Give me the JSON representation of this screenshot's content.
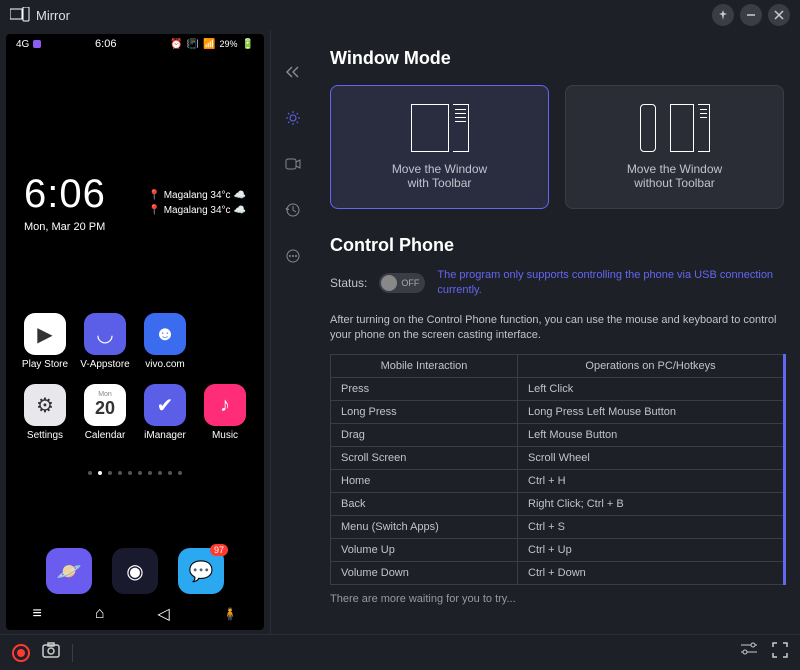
{
  "app": {
    "title": "Mirror"
  },
  "phone": {
    "status": {
      "time": "6:06",
      "battery": "29%",
      "signal": "4G"
    },
    "clock": {
      "time": "6:06",
      "date": "Mon, Mar 20 PM"
    },
    "weather": [
      {
        "text": "Magalang 34°c"
      },
      {
        "text": "Magalang 34°c"
      }
    ],
    "apps_row1": [
      {
        "label": "Play Store",
        "bg": "#ffffff",
        "glyph": "▶"
      },
      {
        "label": "V-Appstore",
        "bg": "#5b5fe8",
        "glyph": "◡"
      },
      {
        "label": "vivo.com",
        "bg": "#3b6cf0",
        "glyph": "☻"
      }
    ],
    "apps_row2": [
      {
        "label": "Settings",
        "bg": "#e8e8ec",
        "glyph": "⚙"
      },
      {
        "label": "Calendar",
        "bg": "#ffffff",
        "glyph": "20",
        "sub": "Mon"
      },
      {
        "label": "iManager",
        "bg": "#5b5fe8",
        "glyph": "✔"
      },
      {
        "label": "Music",
        "bg": "#ff2d78",
        "glyph": "♪"
      }
    ],
    "dock": [
      {
        "name": "browser",
        "bg": "#6b5cf0",
        "glyph": "🪐"
      },
      {
        "name": "camera",
        "bg": "#1a1a2e",
        "glyph": "◉"
      },
      {
        "name": "messages",
        "bg": "#2aa8f0",
        "glyph": "💬",
        "badge": "97"
      }
    ]
  },
  "content": {
    "window_mode_title": "Window Mode",
    "mode_with": "Move the Window\nwith Toolbar",
    "mode_without": "Move the Window\nwithout Toolbar",
    "control_phone_title": "Control Phone",
    "status_label": "Status:",
    "toggle_text": "OFF",
    "status_hint": "The program only supports controlling the phone via USB connection currently.",
    "control_desc": "After turning on the Control Phone function, you can use the mouse and keyboard to control your phone on the screen casting interface.",
    "table": {
      "h1": "Mobile Interaction",
      "h2": "Operations on PC/Hotkeys",
      "rows": [
        {
          "a": "Press",
          "b": "Left Click"
        },
        {
          "a": "Long Press",
          "b": "Long Press Left Mouse Button"
        },
        {
          "a": "Drag",
          "b": "Left Mouse Button"
        },
        {
          "a": "Scroll Screen",
          "b": "Scroll Wheel"
        },
        {
          "a": "Home",
          "b": "Ctrl + H"
        },
        {
          "a": "Back",
          "b": "Right Click; Ctrl + B"
        },
        {
          "a": "Menu (Switch Apps)",
          "b": "Ctrl + S"
        },
        {
          "a": "Volume Up",
          "b": "Ctrl + Up"
        },
        {
          "a": "Volume Down",
          "b": "Ctrl + Down"
        }
      ]
    },
    "try_more": "There are more waiting for you to try..."
  }
}
